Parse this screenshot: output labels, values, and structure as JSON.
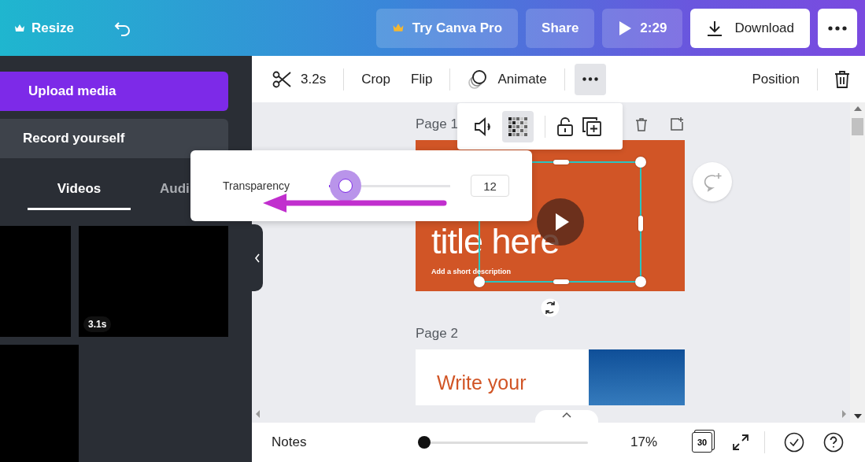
{
  "topbar": {
    "resize": "Resize",
    "try_pro": "Try Canva Pro",
    "share": "Share",
    "play_time": "2:29",
    "download": "Download"
  },
  "sidebar": {
    "upload": "Upload media",
    "record": "Record yourself",
    "tabs": [
      {
        "label": "Videos",
        "selected": true
      },
      {
        "label": "Audi",
        "selected": false
      }
    ],
    "thumbnails": [
      {
        "kind": "video"
      },
      {
        "kind": "video",
        "duration": "3.1s"
      },
      {
        "kind": "video"
      }
    ]
  },
  "toolbar": {
    "duration": "3.2s",
    "crop": "Crop",
    "flip": "Flip",
    "animate": "Animate",
    "more_selected": true,
    "position": "Position"
  },
  "element_toolbar": {
    "transparency_selected": true
  },
  "transparency_popup": {
    "label": "Transparency",
    "level": 0.12,
    "value": "12"
  },
  "pages": [
    {
      "label": "Page 1",
      "kind": "title",
      "title": "title here",
      "description": "Add a short description",
      "video_selected": true
    },
    {
      "label": "Page 2",
      "kind": "topic",
      "heading": "Write your"
    }
  ],
  "bottom_bar": {
    "notes": "Notes",
    "zoom_slider": {
      "level": 0
    },
    "zoom": "17%",
    "page_count": "30"
  }
}
